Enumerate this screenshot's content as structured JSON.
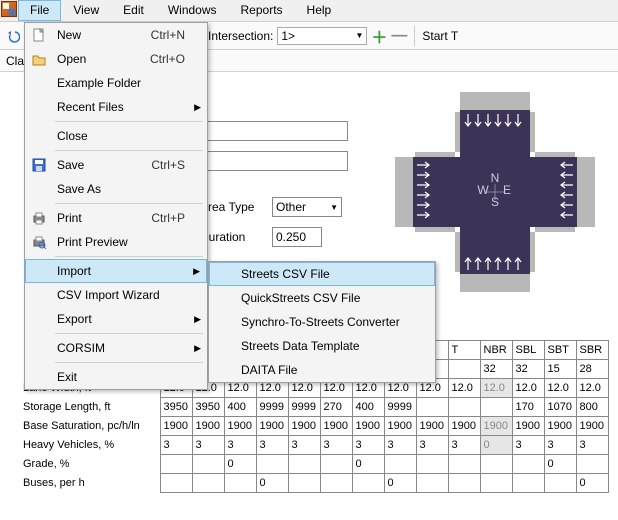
{
  "menubar": {
    "items": [
      "File",
      "View",
      "Edit",
      "Windows",
      "Reports",
      "Help"
    ],
    "open_index": 0
  },
  "toolbar": {
    "intersection_label": "Intersection:",
    "intersection_value": "1>",
    "start_label": "Start T"
  },
  "second_bar": {
    "label": "Cla"
  },
  "file_menu": {
    "items": [
      {
        "label": "New",
        "shortcut": "Ctrl+N",
        "icon": "new"
      },
      {
        "label": "Open",
        "shortcut": "Ctrl+O",
        "icon": "open"
      },
      {
        "label": "Example Folder"
      },
      {
        "label": "Recent Files",
        "submenu": true
      },
      {
        "sep": true
      },
      {
        "label": "Close"
      },
      {
        "sep": true
      },
      {
        "label": "Save",
        "shortcut": "Ctrl+S",
        "icon": "save"
      },
      {
        "label": "Save As"
      },
      {
        "sep": true
      },
      {
        "label": "Print",
        "shortcut": "Ctrl+P",
        "icon": "print"
      },
      {
        "label": "Print Preview",
        "icon": "print-preview"
      },
      {
        "sep": true
      },
      {
        "label": "Import",
        "submenu": true,
        "open": true
      },
      {
        "label": "CSV Import Wizard"
      },
      {
        "label": "Export",
        "submenu": true
      },
      {
        "sep": true
      },
      {
        "label": "CORSIM",
        "submenu": true
      },
      {
        "sep": true
      },
      {
        "label": "Exit"
      }
    ]
  },
  "import_submenu": {
    "items": [
      {
        "label": "Streets CSV File",
        "highlight": true
      },
      {
        "label": "QuickStreets CSV File"
      },
      {
        "label": "Synchro-To-Streets Converter"
      },
      {
        "label": "Streets Data Template"
      },
      {
        "label": "DAITA File"
      }
    ]
  },
  "fields": {
    "area_type_label": "Area Type",
    "area_type_value": "Other",
    "duration_label": "Duration",
    "duration_value": "0.250"
  },
  "table": {
    "headers": [
      "",
      "",
      "",
      "",
      "",
      "",
      "",
      "",
      "",
      "T",
      "NBR",
      "SBL",
      "SBT",
      "SBR"
    ],
    "rows": [
      {
        "label": "",
        "cells": [
          "",
          "",
          "",
          "",
          "",
          "",
          "",
          "",
          "",
          "",
          "32",
          "32",
          "15",
          "28"
        ]
      },
      {
        "label": "Lane Width, ft",
        "cells": [
          "12.0",
          "12.0",
          "12.0",
          "12.0",
          "12.0",
          "12.0",
          "12.0",
          "12.0",
          "12.0",
          "12.0",
          "12.0",
          "12.0",
          "12.0",
          "12.0"
        ],
        "grey_idx": 10
      },
      {
        "label": "Storage Length, ft",
        "cells": [
          "3950",
          "3950",
          "400",
          "9999",
          "9999",
          "270",
          "400",
          "9999",
          "",
          "",
          "",
          "170",
          "1070",
          "800"
        ]
      },
      {
        "label": "Base Saturation, pc/h/ln",
        "cells": [
          "1900",
          "1900",
          "1900",
          "1900",
          "1900",
          "1900",
          "1900",
          "1900",
          "1900",
          "1900",
          "1900",
          "1900",
          "1900",
          "1900"
        ],
        "grey_idx": 10
      },
      {
        "label": "Heavy Vehicles, %",
        "cells": [
          "3",
          "3",
          "3",
          "3",
          "3",
          "3",
          "3",
          "3",
          "3",
          "3",
          "0",
          "3",
          "3",
          "3"
        ],
        "grey_idx": 10
      },
      {
        "label": "Grade, %",
        "cells": [
          "",
          "",
          "0",
          "",
          "",
          "",
          "0",
          "",
          "",
          "",
          "",
          "",
          "0",
          ""
        ]
      },
      {
        "label": "Buses, per h",
        "cells": [
          "",
          "",
          "",
          "0",
          "",
          "",
          "",
          "0",
          "",
          "",
          "",
          "",
          "",
          "0"
        ]
      }
    ]
  },
  "compass": {
    "n": "N",
    "s": "S",
    "e": "E",
    "w": "W"
  }
}
